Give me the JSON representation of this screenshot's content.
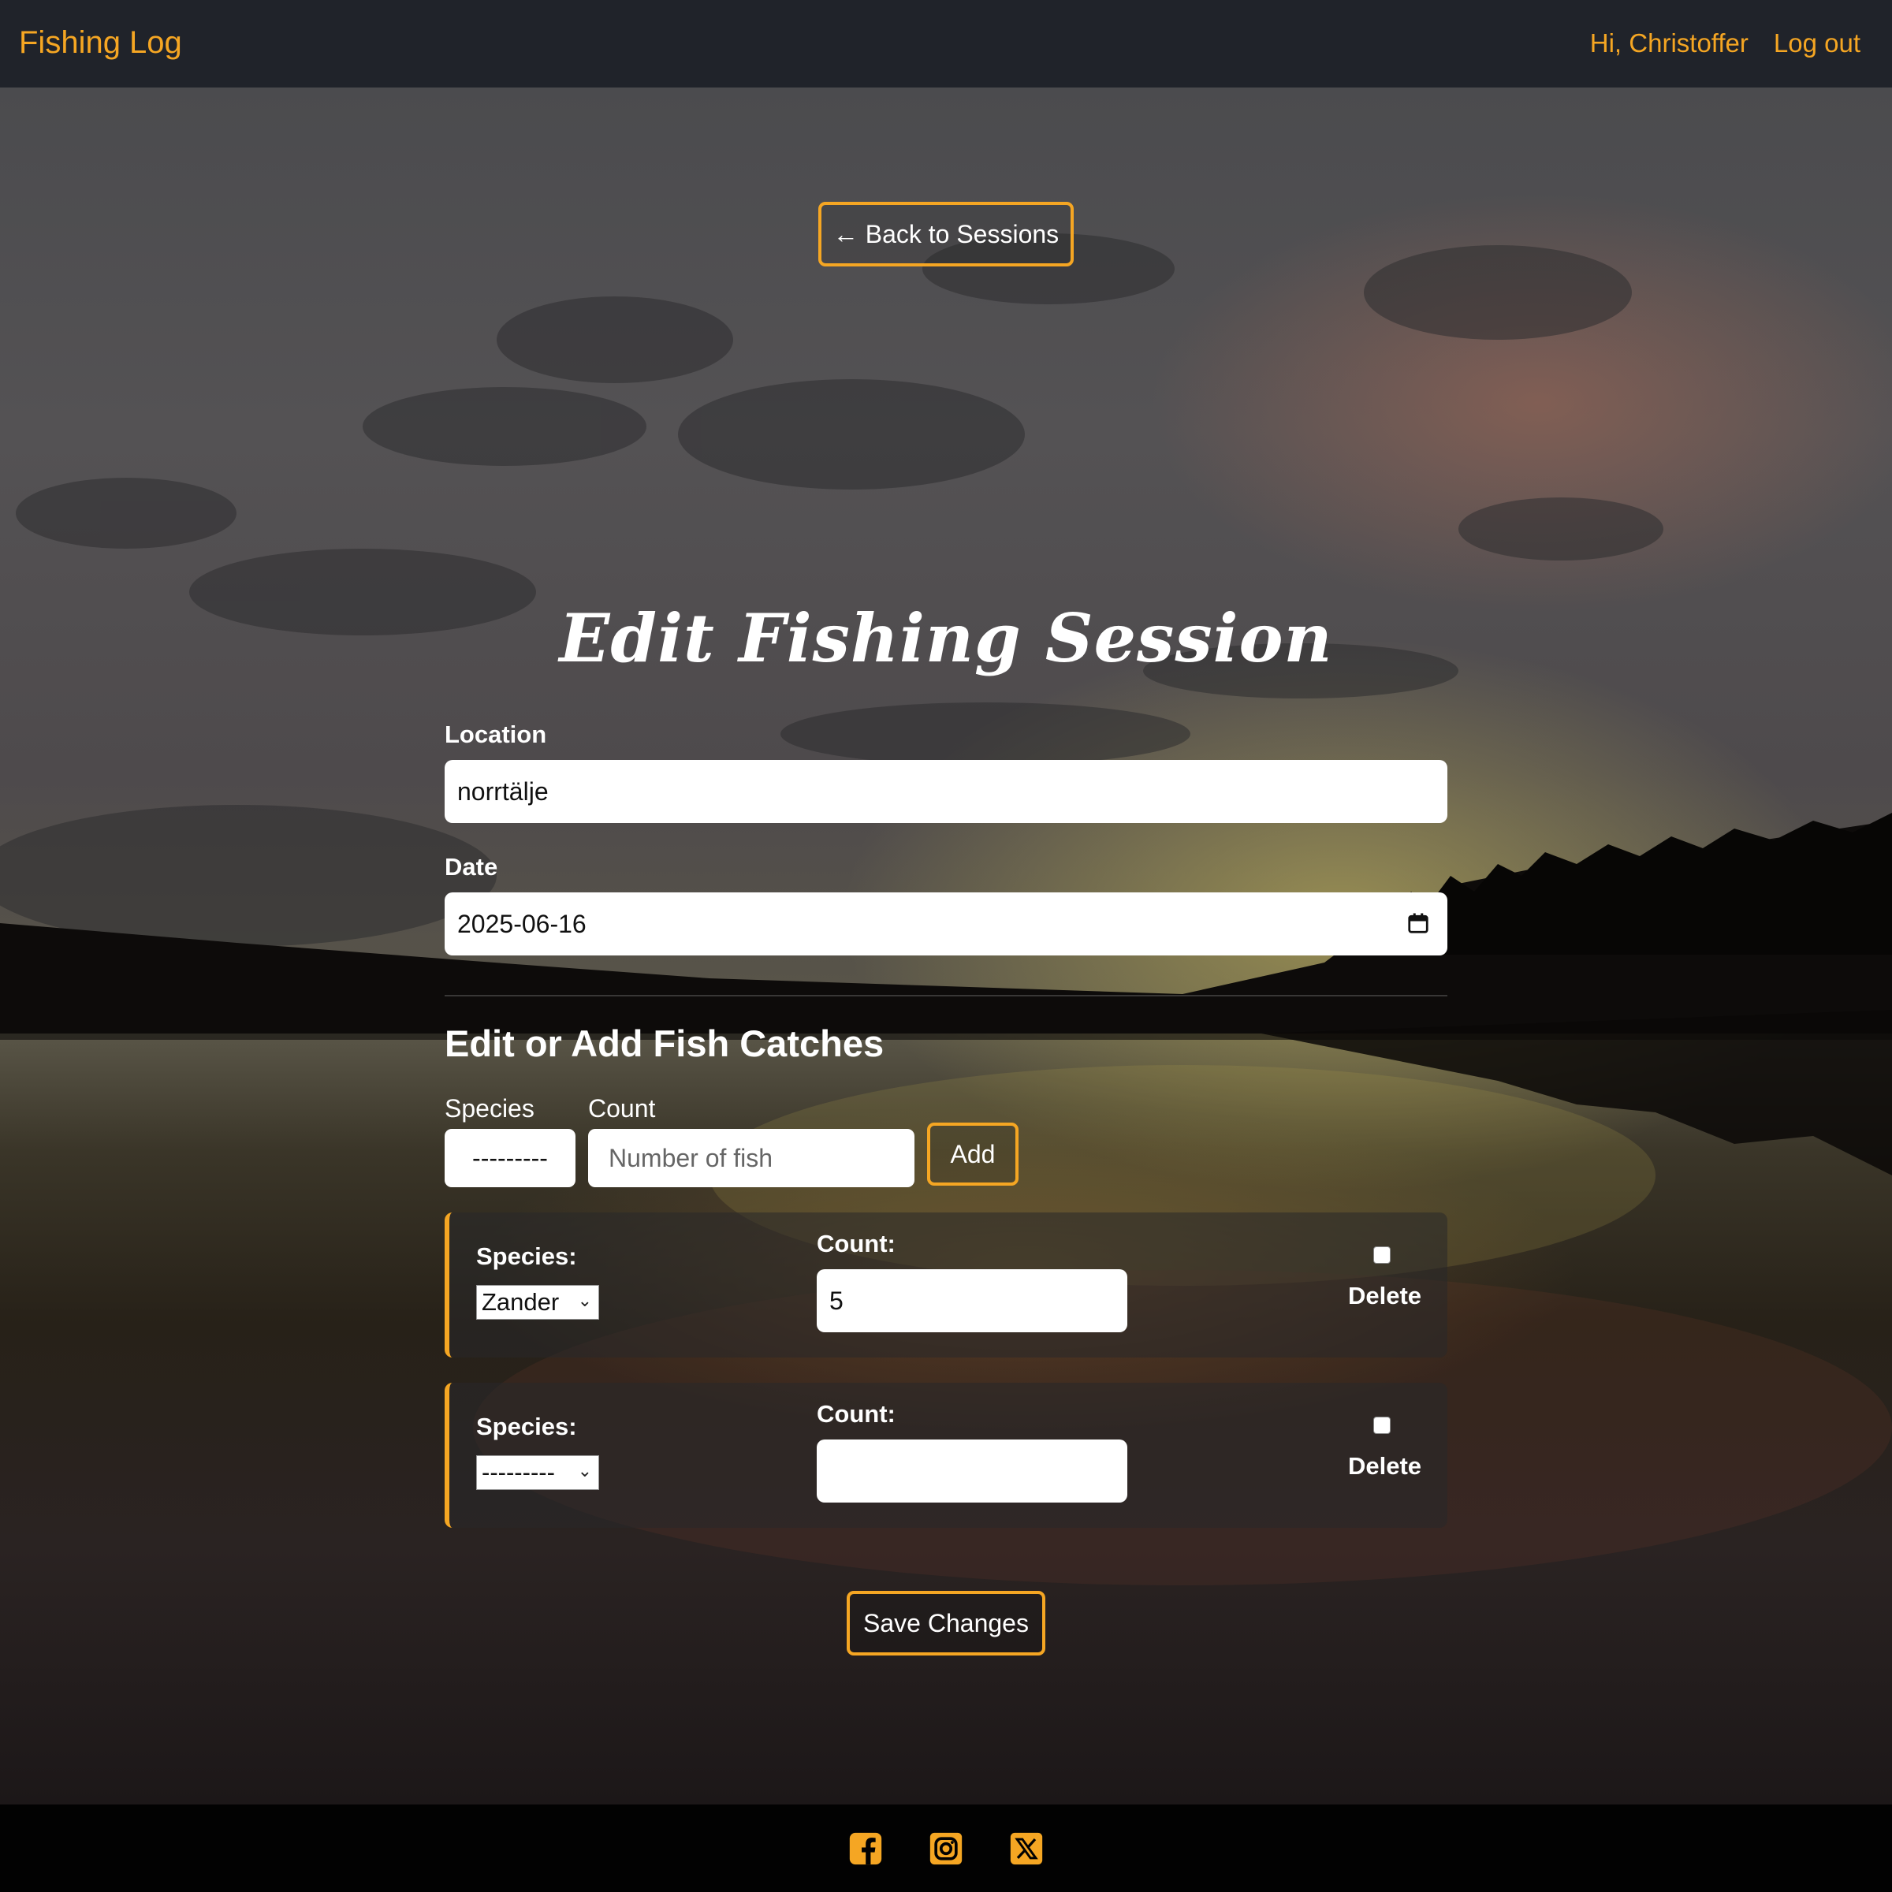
{
  "nav": {
    "brand": "Fishing Log",
    "greeting": "Hi, Christoffer",
    "logout": "Log out"
  },
  "back_button": "← Back to Sessions",
  "page_title": "Edit Fishing Session",
  "form": {
    "location_label": "Location",
    "location_value": "norrtälje",
    "date_label": "Date",
    "date_value": "2025-06-16"
  },
  "catches_section": {
    "title": "Edit or Add Fish Catches",
    "species_label": "Species",
    "species_value": "---------",
    "count_label": "Count",
    "count_placeholder": "Number of fish",
    "add_button": "Add"
  },
  "catches": [
    {
      "species_label": "Species:",
      "species_value": "Zander",
      "count_label": "Count:",
      "count_value": "5",
      "delete_label": "Delete"
    },
    {
      "species_label": "Species:",
      "species_value": "---------",
      "count_label": "Count:",
      "count_value": "",
      "delete_label": "Delete"
    }
  ],
  "save_button": "Save Changes",
  "footer": {
    "icons": [
      "facebook-icon",
      "instagram-icon",
      "x-twitter-icon"
    ]
  },
  "colors": {
    "accent": "#f5a623",
    "navbar": "#20232a",
    "footer": "#020202"
  }
}
